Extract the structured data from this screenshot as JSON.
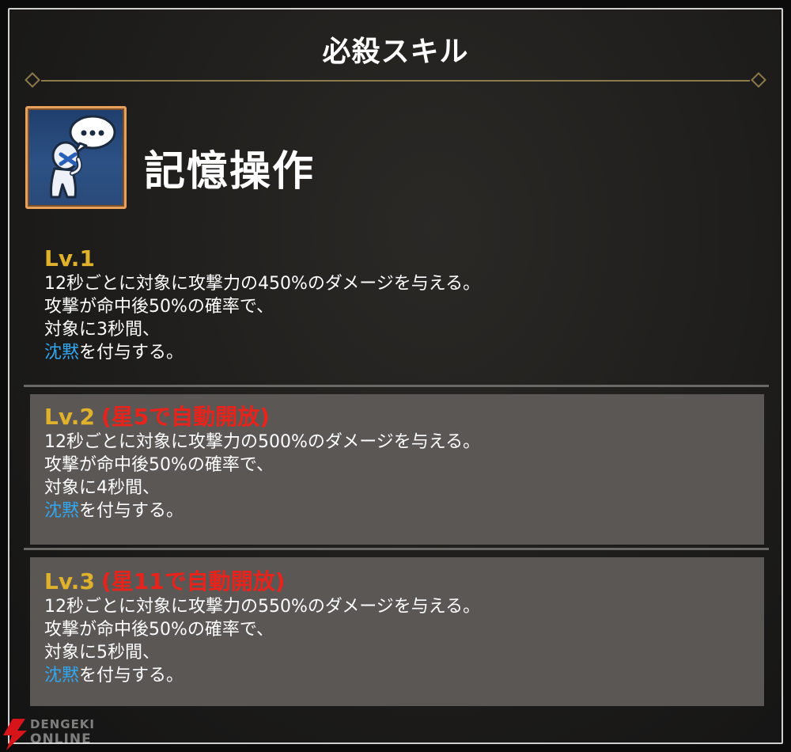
{
  "header": {
    "title": "必殺スキル"
  },
  "skill": {
    "name": "記憶操作",
    "icon": "memory-manipulation-icon"
  },
  "levels": [
    {
      "label": "Lv.1",
      "unlock": "",
      "lines": [
        "12秒ごとに対象に攻撃力の450%のダメージを与える。",
        "攻撃が命中後50%の確率で、",
        "対象に3秒間、"
      ],
      "effect_keyword": "沈黙",
      "effect_suffix": "を付与する。"
    },
    {
      "label": "Lv.2",
      "unlock": "(星5で自動開放)",
      "lines": [
        "12秒ごとに対象に攻撃力の500%のダメージを与える。",
        "攻撃が命中後50%の確率で、",
        "対象に4秒間、"
      ],
      "effect_keyword": "沈黙",
      "effect_suffix": "を付与する。"
    },
    {
      "label": "Lv.3",
      "unlock": "(星11で自動開放)",
      "lines": [
        "12秒ごとに対象に攻撃力の550%のダメージを与える。",
        "攻撃が命中後50%の確率で、",
        "対象に5秒間、"
      ],
      "effect_keyword": "沈黙",
      "effect_suffix": "を付与する。"
    }
  ],
  "watermark": {
    "line1": "DENGEKI",
    "line2": "ONLINE"
  },
  "colors": {
    "level_label": "#e0b22c",
    "unlock_text": "#e8231c",
    "keyword": "#33a6f0",
    "box_background": "#5a5755",
    "icon_frame": "#e7a15b"
  }
}
